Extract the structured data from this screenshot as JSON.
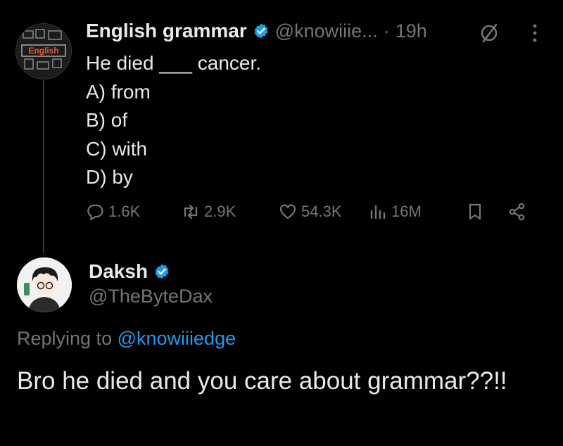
{
  "tweet": {
    "author_name": "English grammar",
    "author_handle": "@knowiiie...",
    "dot": "·",
    "time": "19h",
    "avatar_text": "English",
    "lines": [
      "He died ___ cancer.",
      "A) from",
      "B) of",
      "C) with",
      "D) by"
    ],
    "replies": "1.6K",
    "reposts": "2.9K",
    "likes": "54.3K",
    "views": "16M"
  },
  "reply": {
    "author_name": "Daksh",
    "author_handle": "@TheByteDax",
    "replying_prefix": "Replying to",
    "replying_mention": "@knowiiiedge",
    "text": "Bro he died and you care about grammar??!!"
  },
  "colors": {
    "background": "#000000",
    "text": "#e7e9ea",
    "secondary": "#71767b",
    "accent": "#1d9bf0"
  },
  "icons": [
    "verified-badge-icon",
    "mute-icon",
    "more-icon",
    "reply-icon",
    "repost-icon",
    "like-icon",
    "views-icon",
    "bookmark-icon",
    "share-icon"
  ]
}
